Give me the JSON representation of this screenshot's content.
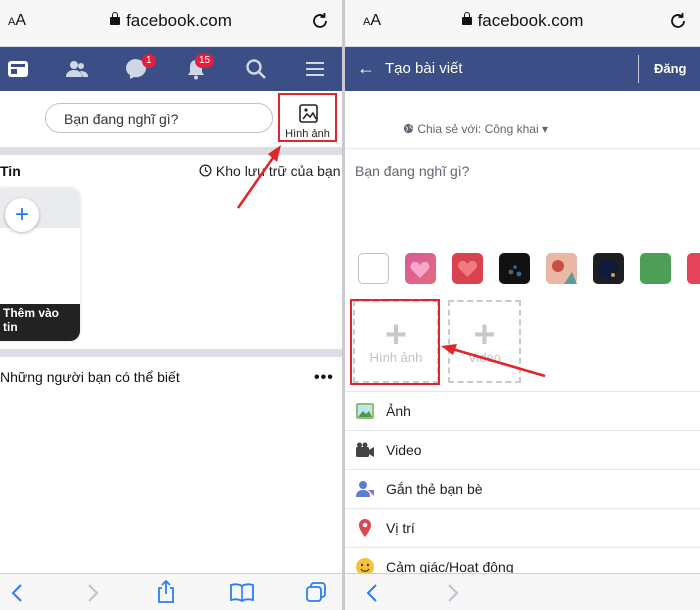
{
  "left": {
    "browser": {
      "aa_label_small": "A",
      "aa_label_big": "A",
      "url": "facebook.com"
    },
    "nav": {
      "messenger_badge": "1",
      "notifications_badge": "15"
    },
    "composer": {
      "placeholder": "Bạn đang nghĩ gì?",
      "photo_label": "Hình ảnh"
    },
    "stories": {
      "title": "Tin",
      "archive": "Kho lưu trữ của bạn",
      "add_label": "Thêm vào tin"
    },
    "pymk": {
      "title": "Những người bạn có thể biết"
    }
  },
  "right": {
    "browser": {
      "aa_label_small": "A",
      "aa_label_big": "A",
      "url": "facebook.com"
    },
    "header": {
      "back": "←",
      "title": "Tạo bài viết",
      "post": "Đăng"
    },
    "share": {
      "label": "Chia sẻ với: Công khai ▾"
    },
    "prompt": "Bạn đang nghĩ gì?",
    "add_photo": "Hình ảnh",
    "add_video": "Video",
    "options": [
      {
        "label": "Ảnh",
        "icon": "photo-icon"
      },
      {
        "label": "Video",
        "icon": "video-camera-icon"
      },
      {
        "label": "Gắn thẻ bạn bè",
        "icon": "tag-friends-icon"
      },
      {
        "label": "Vị trí",
        "icon": "location-pin-icon"
      },
      {
        "label": "Cảm giác/Hoạt động",
        "icon": "emoji-icon"
      }
    ],
    "swatch_colors": [
      "#ffffff",
      "#e5578f",
      "#d9434f",
      "#111111",
      "#d86f62",
      "#1d1d22",
      "#4c9f55",
      "#e2445a"
    ]
  },
  "colors": {
    "facebook_blue": "#3b4e85",
    "highlight_red": "#e0262a",
    "badge_red": "#e41e3f"
  }
}
